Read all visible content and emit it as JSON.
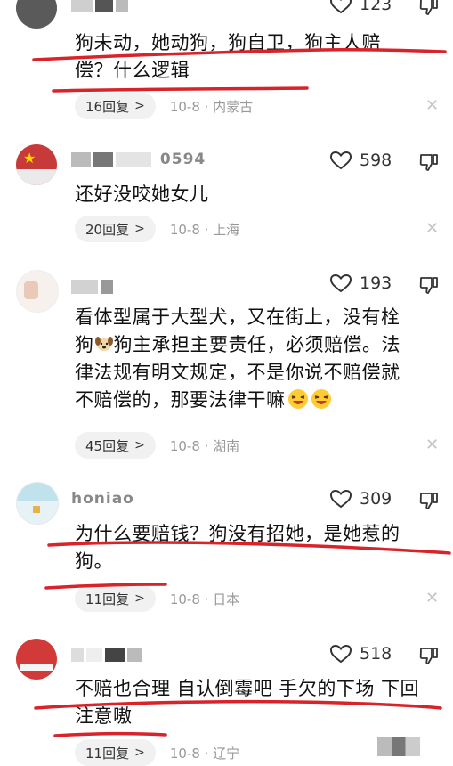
{
  "comments": [
    {
      "username": "",
      "likes": "123",
      "text": "狗未动，她动狗，狗自卫，狗主人赔偿？什么逻辑",
      "text_lines": [
        "狗未动，她动狗，狗自卫，狗主人赔",
        "偿？什么逻辑"
      ],
      "replies": "16回复",
      "meta": "10-8 · 内蒙古"
    },
    {
      "username": "0594",
      "likes": "598",
      "text_lines": [
        "还好没咬她女儿"
      ],
      "replies": "20回复",
      "meta": "10-8 · 上海"
    },
    {
      "username": "",
      "likes": "193",
      "text_lines": [
        "看体型属于大型犬，又在街上，没有栓",
        "狗",
        "狗主承担主要责任，必须赔偿。法",
        "律法规有明文规定，不是你说不赔偿就",
        "不赔偿的，那要法律干嘛"
      ],
      "replies": "45回复",
      "meta": "10-8 · 湖南"
    },
    {
      "username": "honiao",
      "likes": "309",
      "text_lines": [
        "为什么要赔钱？狗没有招她，是她惹的",
        "狗。"
      ],
      "replies": "11回复",
      "meta": "10-8 · 日本"
    },
    {
      "username": "",
      "likes": "518",
      "text_lines": [
        "不赔也合理 自认倒霉吧 手欠的下场 下回",
        "注意嗷"
      ],
      "replies": "11回复",
      "meta": "10-8 · 辽宁"
    }
  ],
  "icons": {
    "like": "heart-outline-icon",
    "dislike": "thumbs-down-icon",
    "close": "close-icon",
    "chevron": "chevron-right-icon"
  },
  "colors": {
    "annotation": "#d8232a",
    "pill": "#f1f1f1",
    "meta": "#999999"
  }
}
